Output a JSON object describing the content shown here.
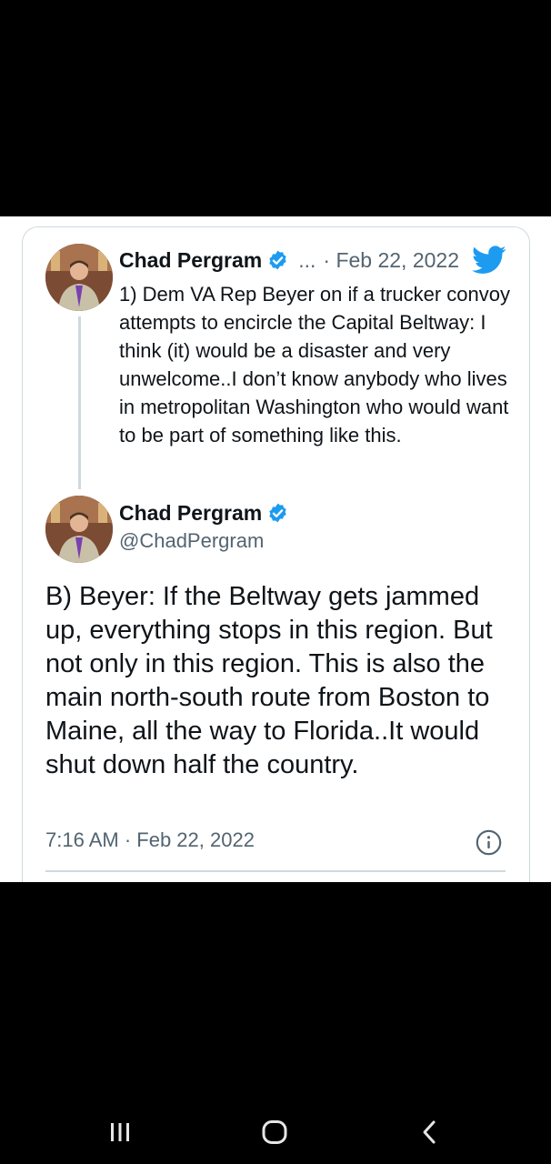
{
  "quoted_tweet": {
    "author_name": "Chad Pergram",
    "more": "...",
    "date": "· Feb 22, 2022",
    "text": "1) Dem VA Rep Beyer on if a trucker convoy attempts to encircle the Capital Beltway: I think (it) would be a disaster and very unwelcome..I don’t know anybody who lives in metropolitan Washington who would want to be part of something like this."
  },
  "main_tweet": {
    "author_name": "Chad Pergram",
    "handle": "@ChadPergram",
    "text": "B) Beyer: If the Beltway gets jammed up, everything stops in this region. But not only in this region. This is also the main north-south route from Boston to Maine, all the way to Florida..It would shut down half the country.",
    "timestamp": "7:16 AM · Feb 22, 2022"
  },
  "icons": {
    "verified": "verified-badge-icon",
    "bird": "twitter-bird-icon",
    "info": "info-icon",
    "nav_recents": "recents-icon",
    "nav_home": "home-icon",
    "nav_back": "back-icon"
  },
  "colors": {
    "twitter_blue": "#1d9bf0",
    "text": "#0f1419",
    "secondary_text": "#536471",
    "border": "#cfd9de"
  }
}
